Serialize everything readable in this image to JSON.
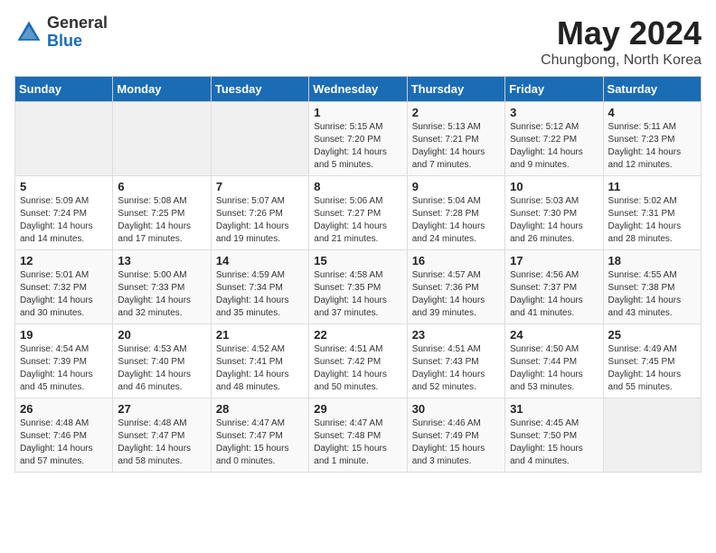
{
  "header": {
    "logo_general": "General",
    "logo_blue": "Blue",
    "month_year": "May 2024",
    "location": "Chungbong, North Korea"
  },
  "weekdays": [
    "Sunday",
    "Monday",
    "Tuesday",
    "Wednesday",
    "Thursday",
    "Friday",
    "Saturday"
  ],
  "weeks": [
    [
      {
        "day": "",
        "empty": true
      },
      {
        "day": "",
        "empty": true
      },
      {
        "day": "",
        "empty": true
      },
      {
        "day": "1",
        "sunrise": "Sunrise: 5:15 AM",
        "sunset": "Sunset: 7:20 PM",
        "daylight": "Daylight: 14 hours and 5 minutes."
      },
      {
        "day": "2",
        "sunrise": "Sunrise: 5:13 AM",
        "sunset": "Sunset: 7:21 PM",
        "daylight": "Daylight: 14 hours and 7 minutes."
      },
      {
        "day": "3",
        "sunrise": "Sunrise: 5:12 AM",
        "sunset": "Sunset: 7:22 PM",
        "daylight": "Daylight: 14 hours and 9 minutes."
      },
      {
        "day": "4",
        "sunrise": "Sunrise: 5:11 AM",
        "sunset": "Sunset: 7:23 PM",
        "daylight": "Daylight: 14 hours and 12 minutes."
      }
    ],
    [
      {
        "day": "5",
        "sunrise": "Sunrise: 5:09 AM",
        "sunset": "Sunset: 7:24 PM",
        "daylight": "Daylight: 14 hours and 14 minutes."
      },
      {
        "day": "6",
        "sunrise": "Sunrise: 5:08 AM",
        "sunset": "Sunset: 7:25 PM",
        "daylight": "Daylight: 14 hours and 17 minutes."
      },
      {
        "day": "7",
        "sunrise": "Sunrise: 5:07 AM",
        "sunset": "Sunset: 7:26 PM",
        "daylight": "Daylight: 14 hours and 19 minutes."
      },
      {
        "day": "8",
        "sunrise": "Sunrise: 5:06 AM",
        "sunset": "Sunset: 7:27 PM",
        "daylight": "Daylight: 14 hours and 21 minutes."
      },
      {
        "day": "9",
        "sunrise": "Sunrise: 5:04 AM",
        "sunset": "Sunset: 7:28 PM",
        "daylight": "Daylight: 14 hours and 24 minutes."
      },
      {
        "day": "10",
        "sunrise": "Sunrise: 5:03 AM",
        "sunset": "Sunset: 7:30 PM",
        "daylight": "Daylight: 14 hours and 26 minutes."
      },
      {
        "day": "11",
        "sunrise": "Sunrise: 5:02 AM",
        "sunset": "Sunset: 7:31 PM",
        "daylight": "Daylight: 14 hours and 28 minutes."
      }
    ],
    [
      {
        "day": "12",
        "sunrise": "Sunrise: 5:01 AM",
        "sunset": "Sunset: 7:32 PM",
        "daylight": "Daylight: 14 hours and 30 minutes."
      },
      {
        "day": "13",
        "sunrise": "Sunrise: 5:00 AM",
        "sunset": "Sunset: 7:33 PM",
        "daylight": "Daylight: 14 hours and 32 minutes."
      },
      {
        "day": "14",
        "sunrise": "Sunrise: 4:59 AM",
        "sunset": "Sunset: 7:34 PM",
        "daylight": "Daylight: 14 hours and 35 minutes."
      },
      {
        "day": "15",
        "sunrise": "Sunrise: 4:58 AM",
        "sunset": "Sunset: 7:35 PM",
        "daylight": "Daylight: 14 hours and 37 minutes."
      },
      {
        "day": "16",
        "sunrise": "Sunrise: 4:57 AM",
        "sunset": "Sunset: 7:36 PM",
        "daylight": "Daylight: 14 hours and 39 minutes."
      },
      {
        "day": "17",
        "sunrise": "Sunrise: 4:56 AM",
        "sunset": "Sunset: 7:37 PM",
        "daylight": "Daylight: 14 hours and 41 minutes."
      },
      {
        "day": "18",
        "sunrise": "Sunrise: 4:55 AM",
        "sunset": "Sunset: 7:38 PM",
        "daylight": "Daylight: 14 hours and 43 minutes."
      }
    ],
    [
      {
        "day": "19",
        "sunrise": "Sunrise: 4:54 AM",
        "sunset": "Sunset: 7:39 PM",
        "daylight": "Daylight: 14 hours and 45 minutes."
      },
      {
        "day": "20",
        "sunrise": "Sunrise: 4:53 AM",
        "sunset": "Sunset: 7:40 PM",
        "daylight": "Daylight: 14 hours and 46 minutes."
      },
      {
        "day": "21",
        "sunrise": "Sunrise: 4:52 AM",
        "sunset": "Sunset: 7:41 PM",
        "daylight": "Daylight: 14 hours and 48 minutes."
      },
      {
        "day": "22",
        "sunrise": "Sunrise: 4:51 AM",
        "sunset": "Sunset: 7:42 PM",
        "daylight": "Daylight: 14 hours and 50 minutes."
      },
      {
        "day": "23",
        "sunrise": "Sunrise: 4:51 AM",
        "sunset": "Sunset: 7:43 PM",
        "daylight": "Daylight: 14 hours and 52 minutes."
      },
      {
        "day": "24",
        "sunrise": "Sunrise: 4:50 AM",
        "sunset": "Sunset: 7:44 PM",
        "daylight": "Daylight: 14 hours and 53 minutes."
      },
      {
        "day": "25",
        "sunrise": "Sunrise: 4:49 AM",
        "sunset": "Sunset: 7:45 PM",
        "daylight": "Daylight: 14 hours and 55 minutes."
      }
    ],
    [
      {
        "day": "26",
        "sunrise": "Sunrise: 4:48 AM",
        "sunset": "Sunset: 7:46 PM",
        "daylight": "Daylight: 14 hours and 57 minutes."
      },
      {
        "day": "27",
        "sunrise": "Sunrise: 4:48 AM",
        "sunset": "Sunset: 7:47 PM",
        "daylight": "Daylight: 14 hours and 58 minutes."
      },
      {
        "day": "28",
        "sunrise": "Sunrise: 4:47 AM",
        "sunset": "Sunset: 7:47 PM",
        "daylight": "Daylight: 15 hours and 0 minutes."
      },
      {
        "day": "29",
        "sunrise": "Sunrise: 4:47 AM",
        "sunset": "Sunset: 7:48 PM",
        "daylight": "Daylight: 15 hours and 1 minute."
      },
      {
        "day": "30",
        "sunrise": "Sunrise: 4:46 AM",
        "sunset": "Sunset: 7:49 PM",
        "daylight": "Daylight: 15 hours and 3 minutes."
      },
      {
        "day": "31",
        "sunrise": "Sunrise: 4:45 AM",
        "sunset": "Sunset: 7:50 PM",
        "daylight": "Daylight: 15 hours and 4 minutes."
      },
      {
        "day": "",
        "empty": true
      }
    ]
  ]
}
